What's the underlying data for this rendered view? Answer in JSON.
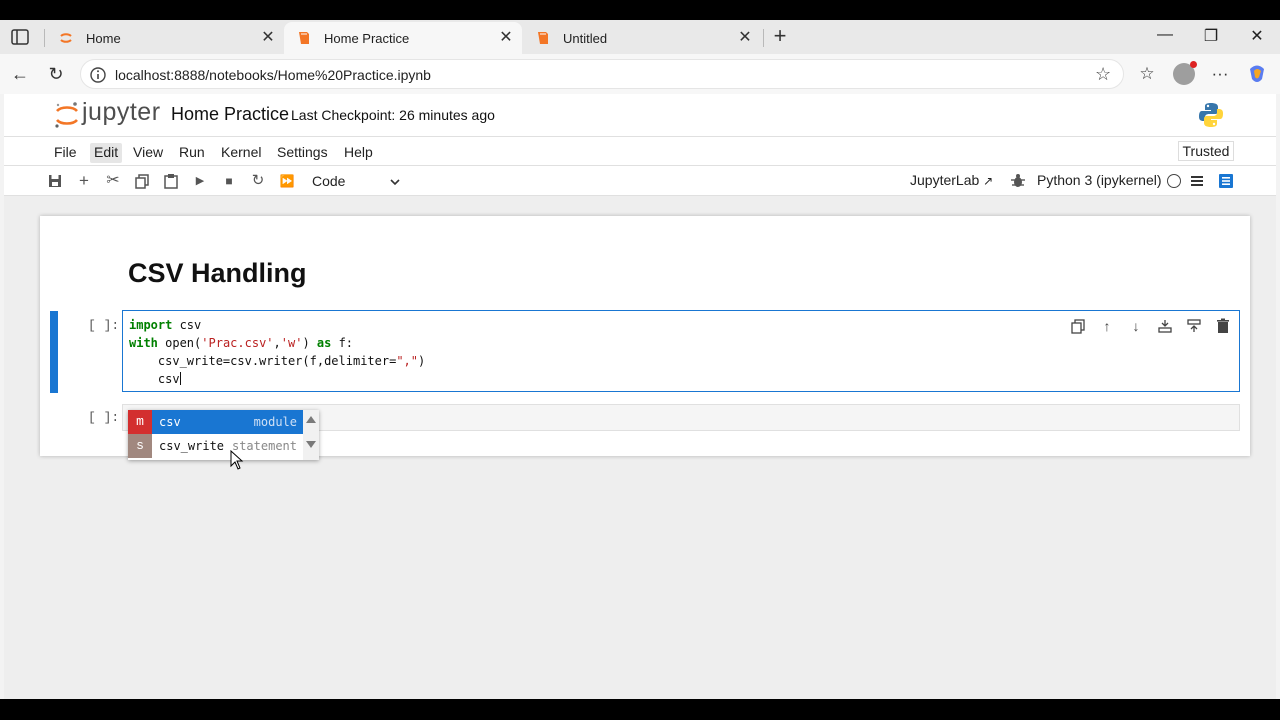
{
  "browser": {
    "tabs": [
      {
        "label": "Home",
        "active": false
      },
      {
        "label": "Home Practice",
        "active": true
      },
      {
        "label": "Untitled",
        "active": false
      }
    ],
    "url": "localhost:8888/notebooks/Home%20Practice.ipynb"
  },
  "jupyter": {
    "logo_text": "jupyter",
    "notebook_title": "Home Practice",
    "checkpoint": "Last Checkpoint: 26 minutes ago",
    "menu": [
      "File",
      "Edit",
      "View",
      "Run",
      "Kernel",
      "Settings",
      "Help"
    ],
    "trusted_label": "Trusted",
    "cell_type": "Code",
    "jupyterlab_label": "JupyterLab",
    "kernel_label": "Python 3 (ipykernel)"
  },
  "notebook": {
    "heading": "CSV Handling",
    "active_cell": {
      "prompt": "[ ]:",
      "lines": {
        "l1_kw": "import",
        "l1_rest": " csv",
        "l2_kw": "with",
        "l2_a": " open(",
        "l2_str1": "'Prac.csv'",
        "l2_b": ",",
        "l2_str2": "'w'",
        "l2_c": ") ",
        "l2_kw2": "as",
        "l2_d": " f:",
        "l3_a": "    csv_write=csv.writer(f,delimiter=",
        "l3_str": "\",\"",
        "l3_b": ")",
        "l4": "    csv"
      }
    },
    "empty_cell": {
      "prompt": "[ ]:"
    }
  },
  "completer": {
    "items": [
      {
        "type": "m",
        "label": "csv",
        "kind": "module",
        "type_color": "#d32f2f"
      },
      {
        "type": "s",
        "label": "csv_write",
        "kind": "statement",
        "type_color": "#a1887f"
      }
    ]
  }
}
